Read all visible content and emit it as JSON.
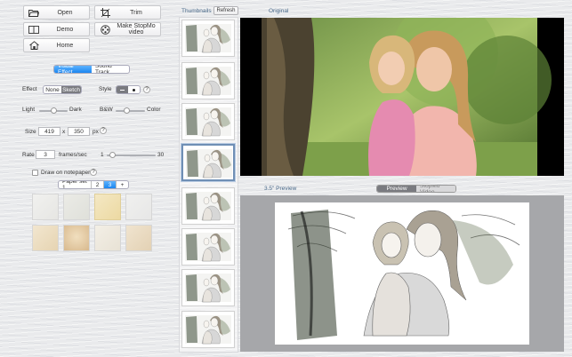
{
  "toolbar": {
    "open_label": "Open",
    "trim_label": "Trim",
    "demo_label": "Demo",
    "make_video_label": "Make StopMo video",
    "home_label": "Home"
  },
  "effect_tabs": {
    "visual_effect": "Visual Effect",
    "sound_track": "Sound Track"
  },
  "effect": {
    "label": "Effect",
    "option_none": "None",
    "option_sketch": "Sketch",
    "selected": "Sketch"
  },
  "style": {
    "label": "Style",
    "help": "?"
  },
  "light_dark": {
    "left_label": "Light",
    "right_label": "Dark",
    "value": 0.5
  },
  "bw_color": {
    "left_label": "B&W",
    "right_label": "Color",
    "value": 0.35
  },
  "size": {
    "label": "Size",
    "width": "419",
    "times": "x",
    "height": "350",
    "unit": "px",
    "help": "?"
  },
  "rate": {
    "label": "Rate",
    "value": "3",
    "unit": "frames/sec",
    "min": "1",
    "max": "30",
    "slider_value": 0.07
  },
  "notepaper": {
    "checkbox_label": "Draw on notepaper",
    "help": "?",
    "checked": false
  },
  "paper_sets": {
    "label": "Paper set 1",
    "pages": [
      "2",
      "3"
    ],
    "add": "+",
    "selected": "3"
  },
  "panels": {
    "thumbnails_label": "Thumbnails",
    "refresh_label": "Refresh",
    "original_label": "Original",
    "preview_label": "3.5\" Preview",
    "preview_tab": "Preview",
    "stopmo_tab": "StopMo Video"
  },
  "colors": {
    "accent": "#1c86f0",
    "selected_thumb_border": "#6f8fb5",
    "preview_background": "#a6a7aa"
  },
  "icons": [
    "open-folder-icon",
    "crop-icon",
    "book-icon",
    "film-reel-icon",
    "home-icon"
  ]
}
